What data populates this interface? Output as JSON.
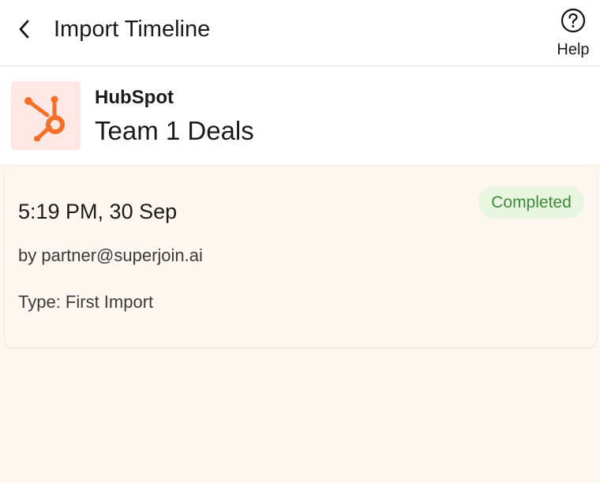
{
  "header": {
    "title": "Import Timeline",
    "back_icon": "chevron-left-icon",
    "help_icon": "question-circle-icon",
    "help_label": "Help"
  },
  "source": {
    "logo_icon": "hubspot-logo",
    "app_name": "HubSpot",
    "object_name": "Team 1 Deals"
  },
  "imports": [
    {
      "time": "5:19 PM, 30 Sep",
      "status": "Completed",
      "by": "by partner@superjoin.ai",
      "type": "Type: First Import"
    }
  ],
  "colors": {
    "accent_orange": "#f56f2a",
    "status_green": "#3f8a3a",
    "status_bg": "#e8f5e1",
    "page_bg": "#fdf7f0"
  }
}
